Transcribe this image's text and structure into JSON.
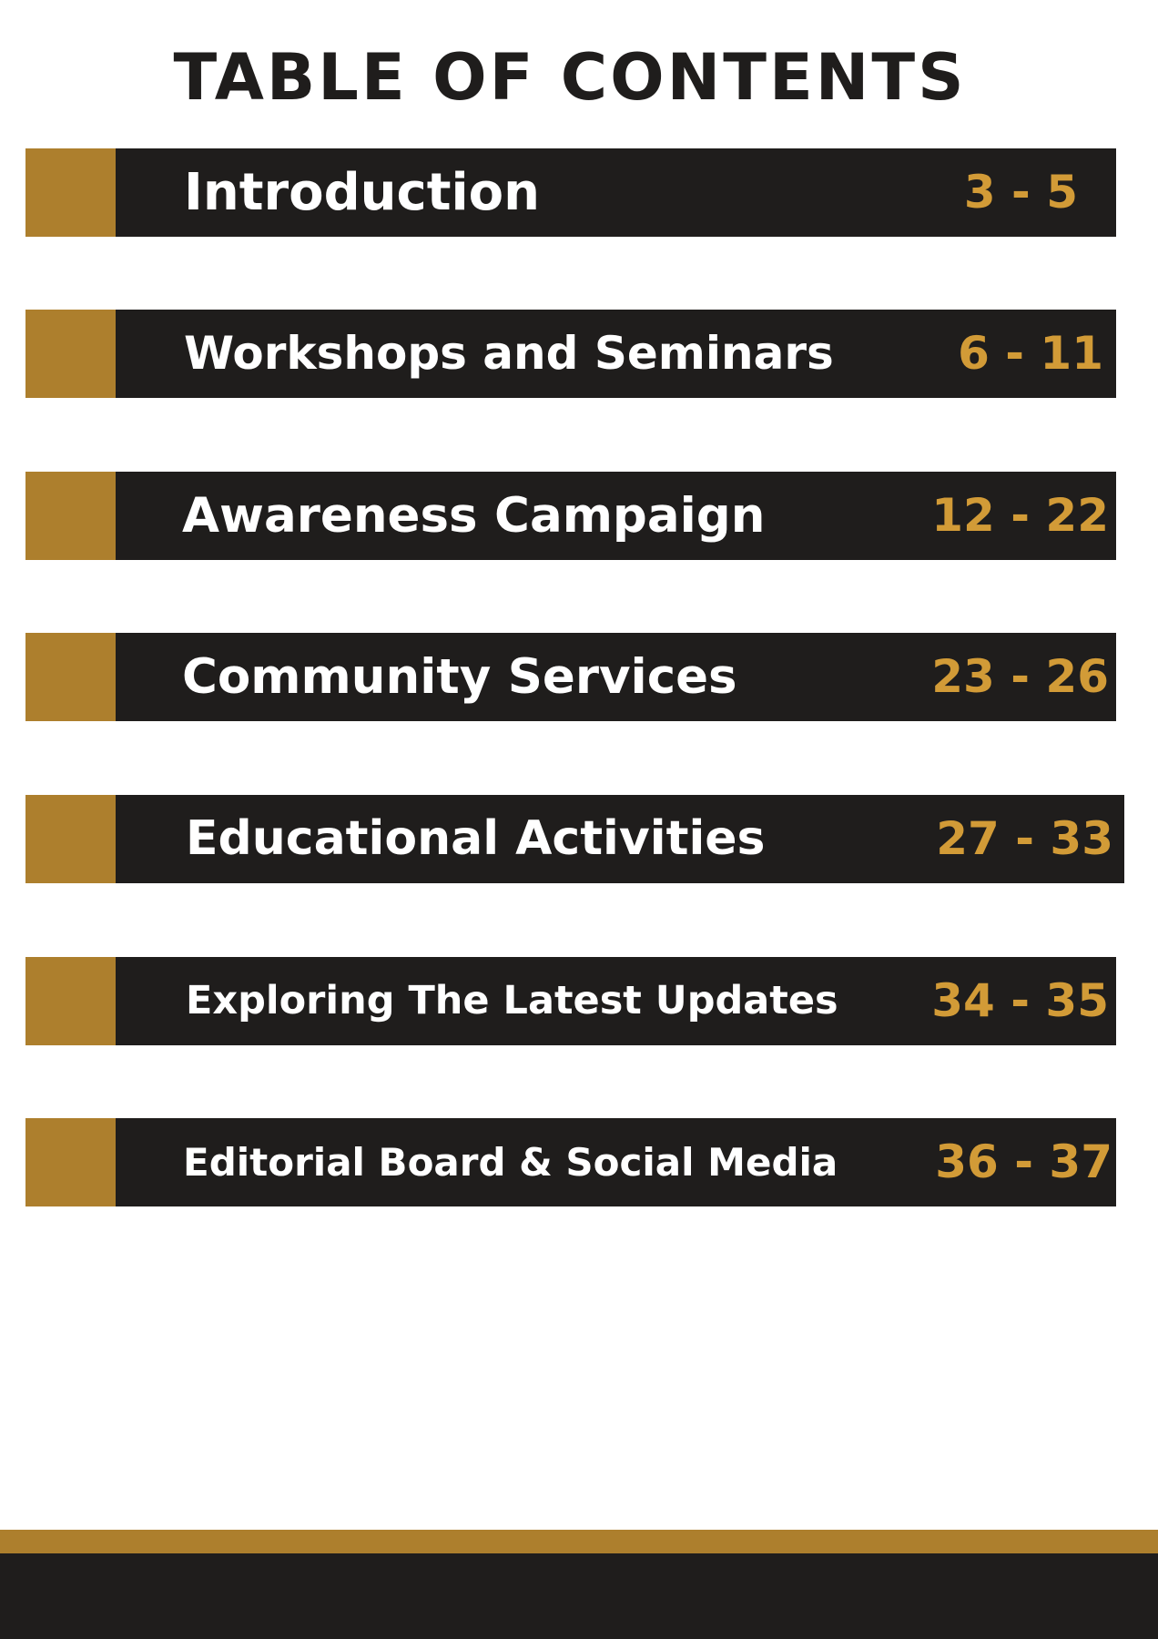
{
  "page_title": "TABLE OF CONTENTS",
  "colors": {
    "gold_tab": "#ad7f2d",
    "bar": "#1f1d1c",
    "page_numbers": "#d29b37",
    "label": "#ffffff"
  },
  "entries": [
    {
      "label": "Introduction",
      "pages": "3 - 5"
    },
    {
      "label": "Workshops and Seminars",
      "pages": "6 - 11"
    },
    {
      "label": "Awareness Campaign",
      "pages": "12 - 22"
    },
    {
      "label": "Community Services",
      "pages": "23 - 26"
    },
    {
      "label": "Educational Activities",
      "pages": "27 - 33"
    },
    {
      "label": "Exploring The Latest Updates",
      "pages": "34 - 35"
    },
    {
      "label": "Editorial Board & Social Media",
      "pages": "36 - 37"
    }
  ]
}
